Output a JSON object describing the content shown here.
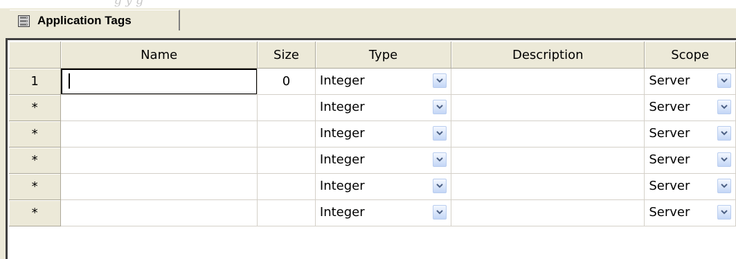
{
  "caption": "g      y      g",
  "tab": {
    "label": "Application Tags",
    "icon": "database-icon"
  },
  "columns": [
    "",
    "Name",
    "Size",
    "Type",
    "Description",
    "Scope"
  ],
  "rows": [
    {
      "marker": "1",
      "name": "",
      "size": "0",
      "type": "Integer",
      "description": "",
      "scope": "Server"
    },
    {
      "marker": "*",
      "name": "",
      "size": "",
      "type": "Integer",
      "description": "",
      "scope": "Server"
    },
    {
      "marker": "*",
      "name": "",
      "size": "",
      "type": "Integer",
      "description": "",
      "scope": "Server"
    },
    {
      "marker": "*",
      "name": "",
      "size": "",
      "type": "Integer",
      "description": "",
      "scope": "Server"
    },
    {
      "marker": "*",
      "name": "",
      "size": "",
      "type": "Integer",
      "description": "",
      "scope": "Server"
    },
    {
      "marker": "*",
      "name": "",
      "size": "",
      "type": "Integer",
      "description": "",
      "scope": "Server"
    }
  ],
  "dropdown_icon": "chevron-down-icon"
}
